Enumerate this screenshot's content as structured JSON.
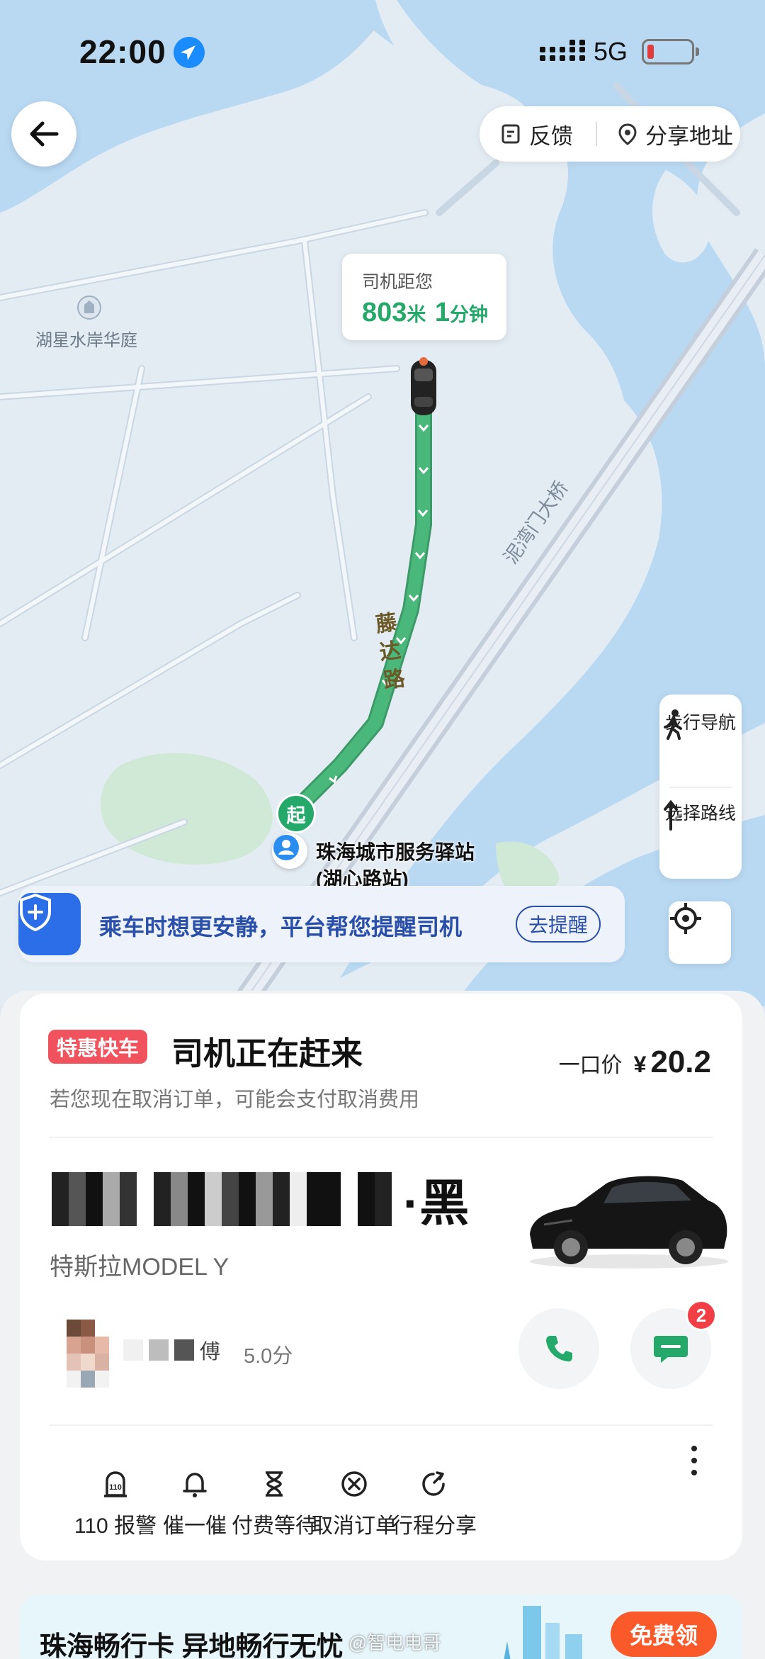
{
  "status_bar": {
    "time": "22:00",
    "network": "5G"
  },
  "top_actions": {
    "feedback": "反馈",
    "share_address": "分享地址"
  },
  "map": {
    "eta": {
      "label": "司机距您",
      "distance": "803",
      "distance_unit": "米",
      "time": "1",
      "time_unit": "分钟"
    },
    "road_route": "藤达路",
    "road_bridge": "泥湾门大桥",
    "poi": "湖星水岸华庭",
    "start_marker": "起",
    "pickup_station_line1": "珠海城市服务驿站",
    "pickup_station_line2": "(湖心路站)",
    "route_color": "#4ab87a",
    "water_color": "#b9d9f3",
    "land_color": "#e4ecf3"
  },
  "side_tools": {
    "walk_nav": "步行导航",
    "choose_route": "选择路线"
  },
  "safety_banner": {
    "text": "乘车时想更安静，平台帮您提醒司机",
    "button": "去提醒"
  },
  "trip": {
    "badge": "特惠快车",
    "status": "司机正在赶来",
    "price_label": "一口价",
    "currency": "¥",
    "price": "20.2",
    "cancel_note": "若您现在取消订单，可能会支付取消费用"
  },
  "vehicle": {
    "plate_color": "·黑",
    "model": "特斯拉MODEL Y"
  },
  "driver": {
    "name_suffix": "傅",
    "rating": "5.0分",
    "unread_messages": "2"
  },
  "actions": [
    {
      "label": "110 报警",
      "icon": "police-110-icon"
    },
    {
      "label": "催一催",
      "icon": "bell-icon"
    },
    {
      "label": "付费等待",
      "icon": "hourglass-icon"
    },
    {
      "label": "取消订单",
      "icon": "cancel-circle-icon"
    },
    {
      "label": "行程分享",
      "icon": "share-arrow-icon"
    }
  ],
  "promo": {
    "title": "珠海畅行卡",
    "subtitle": "异地畅行无忧",
    "button": "免费领"
  },
  "watermark": "@智电电哥",
  "colors": {
    "accent_green": "#25a96a",
    "badge_red": "#f0535e",
    "promo_orange": "#fa5a2a",
    "safety_blue": "#2c6ee8"
  }
}
